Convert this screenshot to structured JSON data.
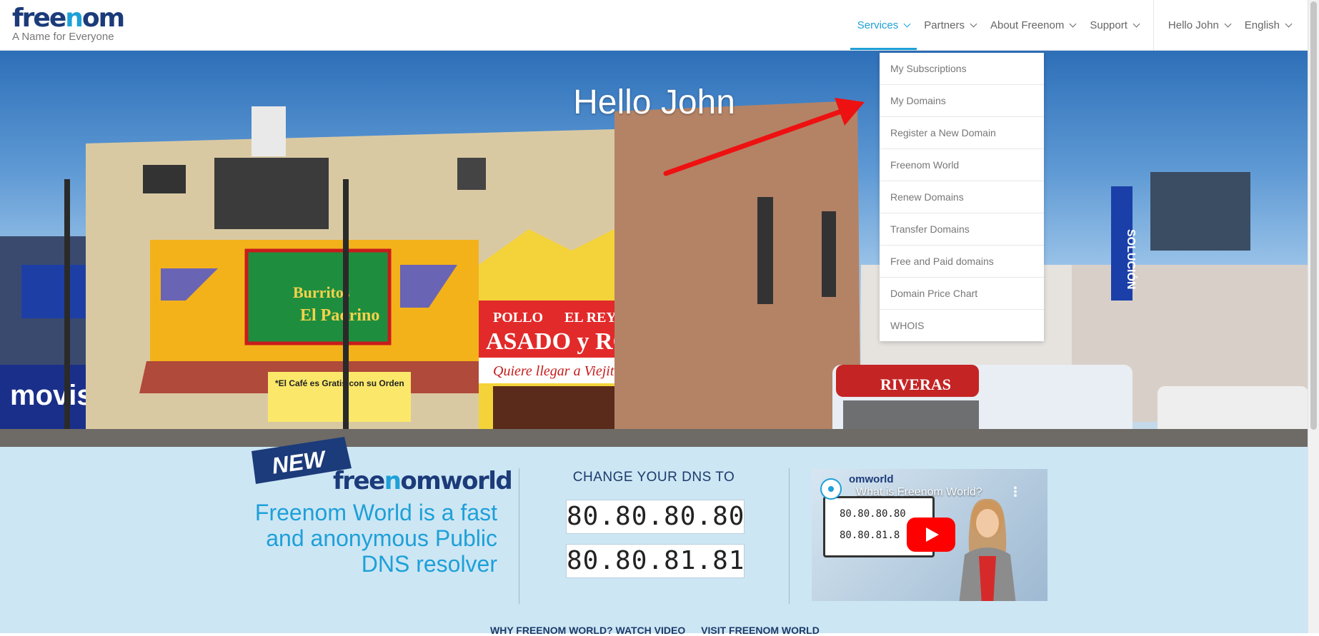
{
  "header": {
    "logo_text_1": "free",
    "logo_text_2": "n",
    "logo_text_3": "om",
    "tagline": "A Name for Everyone",
    "nav": [
      {
        "label": "Services",
        "active": true
      },
      {
        "label": "Partners"
      },
      {
        "label": "About Freenom"
      },
      {
        "label": "Support"
      }
    ],
    "user_label": "Hello John",
    "language": "English"
  },
  "hero": {
    "greeting": "Hello John",
    "sign_movistar": "movistar",
    "sign_burritos_1": "Burritos",
    "sign_burritos_2": "El Padrino",
    "sign_pollo_1": "POLLO",
    "sign_pollo_2": "EL REY DEL POLLO",
    "sign_pollo_3": "ASADO y ROSTIZADO",
    "sign_pollo_4": "Quiere llegar a Viejito Coma Pollito",
    "sign_cafe": "*El Café es Gratis con su Orden",
    "sign_bus": "RIVERAS",
    "sign_solucion": "SOLUCIÓN"
  },
  "services_menu": {
    "items": [
      "My Subscriptions",
      "My Domains",
      "Register a New Domain",
      "Freenom World",
      "Renew Domains",
      "Transfer Domains",
      "Free and Paid domains",
      "Domain Price Chart",
      "WHOIS"
    ]
  },
  "promo": {
    "badge": "NEW",
    "logo_1": "free",
    "logo_2": "n",
    "logo_3": "omworld",
    "description": "Freenom World is a fast and anonymous Public DNS resolver",
    "dns_heading": "CHANGE YOUR DNS TO",
    "dns_primary": "80.80.80.80",
    "dns_secondary": "80.80.81.81",
    "video_title": "What is Freenom World?",
    "video_channel": "omworld",
    "video_line_1": "80.80.80.80",
    "video_line_2": "80.80.81.8",
    "link_watch": "WHY FREENOM WORLD? WATCH VIDEO",
    "link_visit": "VISIT FREENOM WORLD"
  },
  "colors": {
    "accent": "#1ea0d8",
    "navy": "#1b3b7a",
    "band": "#cde6f4",
    "arrow": "#ee1111"
  }
}
